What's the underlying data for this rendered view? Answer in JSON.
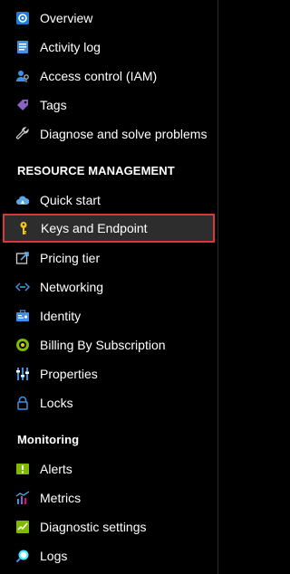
{
  "items_top": [
    {
      "label": "Overview",
      "icon": "overview-icon"
    },
    {
      "label": "Activity log",
      "icon": "activity-log-icon"
    },
    {
      "label": "Access control (IAM)",
      "icon": "access-control-icon"
    },
    {
      "label": "Tags",
      "icon": "tag-icon"
    },
    {
      "label": "Diagnose and solve problems",
      "icon": "wrench-icon"
    }
  ],
  "sections": {
    "resource_management": "RESOURCE MANAGEMENT",
    "monitoring": "Monitoring"
  },
  "items_resource": [
    {
      "label": "Quick start",
      "icon": "cloud-icon"
    },
    {
      "label": "Keys and Endpoint",
      "icon": "key-icon"
    },
    {
      "label": "Pricing tier",
      "icon": "pricing-icon"
    },
    {
      "label": "Networking",
      "icon": "networking-icon"
    },
    {
      "label": "Identity",
      "icon": "identity-icon"
    },
    {
      "label": "Billing By Subscription",
      "icon": "billing-icon"
    },
    {
      "label": "Properties",
      "icon": "properties-icon"
    },
    {
      "label": "Locks",
      "icon": "lock-icon"
    }
  ],
  "items_monitoring": [
    {
      "label": "Alerts",
      "icon": "alerts-icon"
    },
    {
      "label": "Metrics",
      "icon": "metrics-icon"
    },
    {
      "label": "Diagnostic settings",
      "icon": "diagnostic-settings-icon"
    },
    {
      "label": "Logs",
      "icon": "logs-icon"
    }
  ],
  "selected": "Keys and Endpoint",
  "colors": {
    "background": "#000000",
    "selection_border": "#d9383a",
    "selection_bg": "#2d2d2d",
    "accent_blue": "#3c91e6"
  }
}
